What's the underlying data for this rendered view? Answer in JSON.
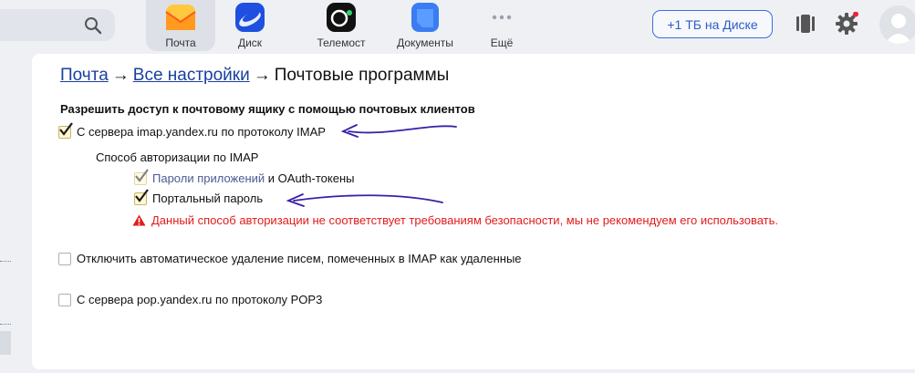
{
  "header": {
    "services": [
      {
        "label": "Почта",
        "icon": "mail-icon",
        "active": true
      },
      {
        "label": "Диск",
        "icon": "disk-icon",
        "active": false
      },
      {
        "label": "Телемост",
        "icon": "telemost-icon",
        "active": false
      },
      {
        "label": "Документы",
        "icon": "documents-icon",
        "active": false
      },
      {
        "label": "Ещё",
        "icon": "more-icon",
        "active": false
      }
    ],
    "disk_button": "+1 ТБ на Диске"
  },
  "breadcrumb": {
    "mail": "Почта",
    "separator": "→",
    "settings": "Все настройки",
    "current": "Почтовые программы"
  },
  "settings": {
    "section_title": "Разрешить доступ к почтовому ящику с помощью почтовых клиентов",
    "imap": {
      "label": "С сервера imap.yandex.ru по протоколу IMAP",
      "checked": true
    },
    "auth_title": "Способ авторизации по IMAP",
    "app_passwords": {
      "link": "Пароли приложений",
      "suffix": " и OAuth-токены",
      "checked": true
    },
    "portal_password": {
      "label": "Портальный пароль",
      "checked": true
    },
    "warning": "Данный способ авторизации не соответствует требованиям безопасности, мы не рекомендуем его использовать.",
    "disable_autodelete": {
      "label": "Отключить автоматическое удаление писем, помеченных в IMAP как удаленные",
      "checked": false
    },
    "pop3": {
      "label": "С сервера pop.yandex.ru по протоколу POP3",
      "checked": false
    }
  },
  "colors": {
    "accent": "#3d6fd9",
    "warning": "#e21b1b",
    "annotation": "#3a1fa8"
  }
}
